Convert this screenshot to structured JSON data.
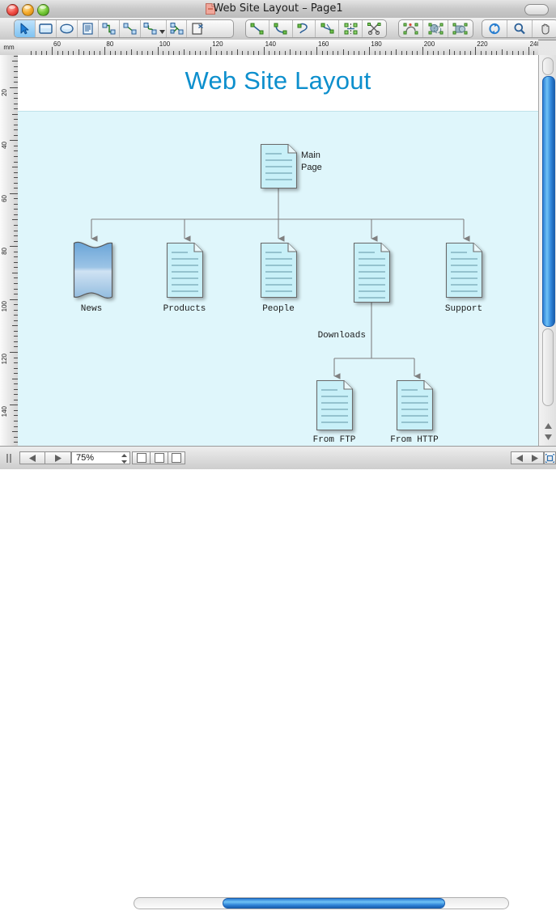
{
  "window": {
    "title": "Web Site Layout – Page1",
    "title_icon": "document-icon",
    "controls": {
      "close": "close-button",
      "minimize": "minimize-button",
      "zoom": "zoom-button"
    }
  },
  "toolbar": {
    "groups": [
      {
        "name": "draw-tools",
        "buttons": [
          {
            "icon": "pointer-select-icon",
            "selected": true
          },
          {
            "icon": "rectangle-icon",
            "selected": false
          },
          {
            "icon": "ellipse-icon",
            "selected": false
          },
          {
            "icon": "text-block-icon",
            "selected": false
          },
          {
            "icon": "orthogonal-connector-icon",
            "selected": false
          },
          {
            "icon": "straight-connector-icon",
            "selected": false
          },
          {
            "icon": "rounded-connector-icon",
            "selected": false
          },
          {
            "icon": "tree-connector-icon",
            "selected": false
          },
          {
            "icon": "delete-node-icon",
            "selected": false
          }
        ]
      },
      {
        "name": "path-tools",
        "buttons": [
          {
            "icon": "line-segment-icon"
          },
          {
            "icon": "curve-segment-icon"
          },
          {
            "icon": "arc-segment-icon"
          },
          {
            "icon": "bezier-node-icon"
          },
          {
            "icon": "mirror-nodes-icon"
          },
          {
            "icon": "cut-path-icon"
          }
        ]
      },
      {
        "name": "shape-ops",
        "buttons": [
          {
            "icon": "rotate-shape-icon"
          },
          {
            "icon": "union-shapes-icon"
          },
          {
            "icon": "group-shapes-icon"
          }
        ]
      },
      {
        "name": "view-tools",
        "buttons": [
          {
            "icon": "refresh-icon"
          },
          {
            "icon": "magnifier-icon"
          },
          {
            "icon": "hand-pan-icon"
          }
        ]
      }
    ]
  },
  "rulers": {
    "unit": "mm",
    "horizontal_labels": [
      "60",
      "80",
      "100",
      "120",
      "140",
      "160",
      "180",
      "200",
      "220",
      "240"
    ],
    "vertical_labels": [
      "20",
      "40",
      "60",
      "80",
      "100",
      "120",
      "140"
    ]
  },
  "document": {
    "title": "Web Site Layout",
    "title_color": "#0d8fcd",
    "canvas_color": "#dff6fb",
    "nodes": [
      {
        "id": "main",
        "label": "Main\nPage",
        "label_lines": [
          "Main",
          "Page"
        ],
        "shape": "document",
        "label_pos": "right"
      },
      {
        "id": "news",
        "label": "News",
        "label_lines": [
          "News"
        ],
        "shape": "wave",
        "label_pos": "below"
      },
      {
        "id": "products",
        "label": "Products",
        "label_lines": [
          "Products"
        ],
        "shape": "document",
        "label_pos": "below"
      },
      {
        "id": "people",
        "label": "People",
        "label_lines": [
          "People"
        ],
        "shape": "document",
        "label_pos": "below"
      },
      {
        "id": "downloads",
        "label": "Downloads",
        "label_lines": [
          "Downloads"
        ],
        "shape": "document",
        "label_pos": "below-left"
      },
      {
        "id": "support",
        "label": "Support",
        "label_lines": [
          "Support"
        ],
        "shape": "document",
        "label_pos": "below"
      },
      {
        "id": "fromftp",
        "label": "From FTP",
        "label_lines": [
          "From FTP"
        ],
        "shape": "document",
        "label_pos": "below"
      },
      {
        "id": "fromhttp",
        "label": "From HTTP",
        "label_lines": [
          "From HTTP"
        ],
        "shape": "document",
        "label_pos": "below"
      }
    ],
    "edges": [
      {
        "from": "main",
        "to": "news"
      },
      {
        "from": "main",
        "to": "products"
      },
      {
        "from": "main",
        "to": "people"
      },
      {
        "from": "main",
        "to": "downloads"
      },
      {
        "from": "main",
        "to": "support"
      },
      {
        "from": "downloads",
        "to": "fromftp"
      },
      {
        "from": "downloads",
        "to": "fromhttp"
      }
    ]
  },
  "statusbar": {
    "zoom_value": "75%",
    "page_prev": "page-prev-button",
    "page_next": "page-next-button",
    "view_modes": [
      "view-mode-1",
      "view-mode-2",
      "view-mode-3"
    ],
    "scroll_prev": "scroll-left-button",
    "scroll_next": "scroll-right-button",
    "fit_button": "fit-page-button"
  }
}
